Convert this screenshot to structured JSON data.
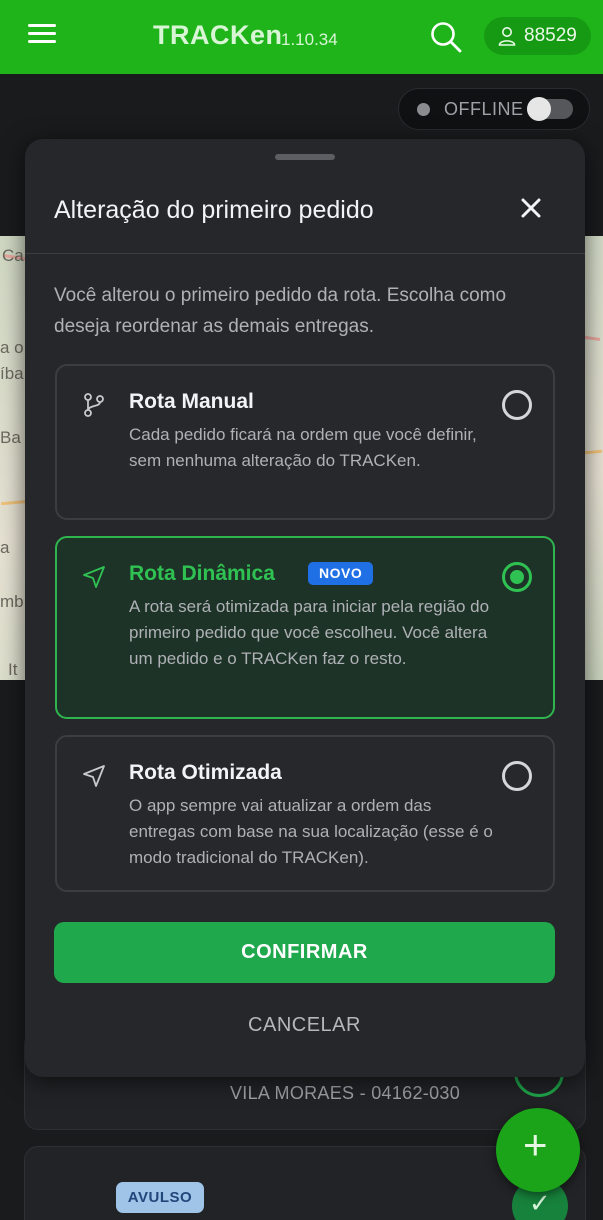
{
  "header": {
    "title": "TRACKen",
    "version": "1.10.34",
    "user_id": "88529",
    "menu_icon": "hamburger-menu-icon",
    "search_icon": "search-icon",
    "user_icon": "user-icon",
    "brand_color": "#1fb51a"
  },
  "status": {
    "label": "OFFLINE",
    "toggle_on": false
  },
  "map": {
    "labels": [
      "Ca",
      "a o",
      "íba",
      "Ba",
      "a",
      "mb",
      "It"
    ]
  },
  "background_list": {
    "address": "VILA MORAES - 04162-030",
    "badge": "AVULSO",
    "fab_label": "+",
    "check_label": "✓"
  },
  "dialog": {
    "title": "Alteração do primeiro pedido",
    "description": "Você alterou o primeiro pedido da rota. Escolha como deseja reordenar as demais entregas.",
    "options": [
      {
        "title": "Rota Manual",
        "description": "Cada pedido ficará na ordem que você definir, sem nenhuma alteração do TRACKen.",
        "icon": "branch-icon",
        "selected": false
      },
      {
        "title": "Rota Dinâmica",
        "badge": "NOVO",
        "description": "A rota será otimizada para iniciar pela região do primeiro pedido que você escolheu. Você altera um pedido e o TRACKen faz o resto.",
        "icon": "navigation-arrow-icon",
        "selected": true
      },
      {
        "title": "Rota Otimizada",
        "description": "O app sempre vai atualizar a ordem das entregas com base na sua localização (esse é o modo tradicional do TRACKen).",
        "icon": "navigation-arrow-icon",
        "selected": false
      }
    ],
    "confirm_label": "CONFIRMAR",
    "cancel_label": "CANCELAR",
    "accent_color": "#2fc253"
  }
}
